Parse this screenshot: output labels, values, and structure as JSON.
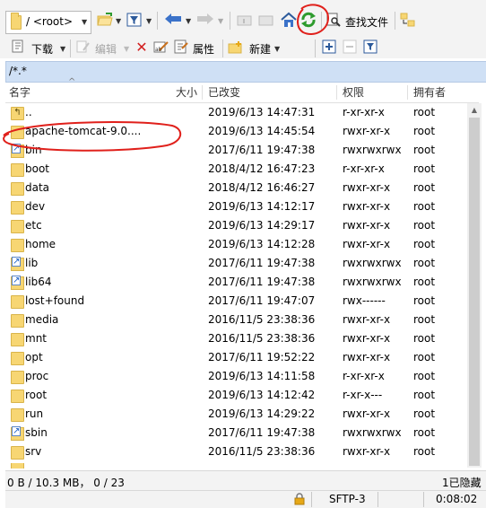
{
  "toolbar_top": {
    "path_combo_value": "/ <root>",
    "find_files_label": "查找文件"
  },
  "toolbar_second": {
    "download_label": "下载",
    "edit_label": "编辑",
    "properties_label": "属性",
    "new_label": "新建"
  },
  "path_bar": {
    "path": "/*.*"
  },
  "columns": {
    "name": "名字",
    "size": "大小",
    "changed": "已改变",
    "rights": "权限",
    "owner": "拥有者"
  },
  "files": [
    {
      "name": "..",
      "changed": "2019/6/13 14:47:31",
      "rights": "r-xr-xr-x",
      "owner": "root",
      "icon": "parent-directory-icon"
    },
    {
      "name": "apache-tomcat-9.0....",
      "changed": "2019/6/13 14:45:54",
      "rights": "rwxr-xr-x",
      "owner": "root",
      "icon": "folder-icon"
    },
    {
      "name": "bin",
      "changed": "2017/6/11 19:47:38",
      "rights": "rwxrwxrwx",
      "owner": "root",
      "icon": "folder-link-icon"
    },
    {
      "name": "boot",
      "changed": "2018/4/12 16:47:23",
      "rights": "r-xr-xr-x",
      "owner": "root",
      "icon": "folder-icon"
    },
    {
      "name": "data",
      "changed": "2018/4/12 16:46:27",
      "rights": "rwxr-xr-x",
      "owner": "root",
      "icon": "folder-icon"
    },
    {
      "name": "dev",
      "changed": "2019/6/13 14:12:17",
      "rights": "rwxr-xr-x",
      "owner": "root",
      "icon": "folder-icon"
    },
    {
      "name": "etc",
      "changed": "2019/6/13 14:29:17",
      "rights": "rwxr-xr-x",
      "owner": "root",
      "icon": "folder-icon"
    },
    {
      "name": "home",
      "changed": "2019/6/13 14:12:28",
      "rights": "rwxr-xr-x",
      "owner": "root",
      "icon": "folder-icon"
    },
    {
      "name": "lib",
      "changed": "2017/6/11 19:47:38",
      "rights": "rwxrwxrwx",
      "owner": "root",
      "icon": "folder-link-icon"
    },
    {
      "name": "lib64",
      "changed": "2017/6/11 19:47:38",
      "rights": "rwxrwxrwx",
      "owner": "root",
      "icon": "folder-link-icon"
    },
    {
      "name": "lost+found",
      "changed": "2017/6/11 19:47:07",
      "rights": "rwx------",
      "owner": "root",
      "icon": "folder-icon"
    },
    {
      "name": "media",
      "changed": "2016/11/5 23:38:36",
      "rights": "rwxr-xr-x",
      "owner": "root",
      "icon": "folder-icon"
    },
    {
      "name": "mnt",
      "changed": "2016/11/5 23:38:36",
      "rights": "rwxr-xr-x",
      "owner": "root",
      "icon": "folder-icon"
    },
    {
      "name": "opt",
      "changed": "2017/6/11 19:52:22",
      "rights": "rwxr-xr-x",
      "owner": "root",
      "icon": "folder-icon"
    },
    {
      "name": "proc",
      "changed": "2019/6/13 14:11:58",
      "rights": "r-xr-xr-x",
      "owner": "root",
      "icon": "folder-icon"
    },
    {
      "name": "root",
      "changed": "2019/6/13 14:12:42",
      "rights": "r-xr-x---",
      "owner": "root",
      "icon": "folder-icon"
    },
    {
      "name": "run",
      "changed": "2019/6/13 14:29:22",
      "rights": "rwxr-xr-x",
      "owner": "root",
      "icon": "folder-icon"
    },
    {
      "name": "sbin",
      "changed": "2017/6/11 19:47:38",
      "rights": "rwxrwxrwx",
      "owner": "root",
      "icon": "folder-link-icon"
    },
    {
      "name": "srv",
      "changed": "2016/11/5 23:38:36",
      "rights": "rwxr-xr-x",
      "owner": "root",
      "icon": "folder-icon"
    }
  ],
  "status_bar": {
    "selection": "0 B / 10.3 MB， 0 / 23",
    "hidden": "1已隐藏",
    "protocol": "SFTP-3",
    "elapsed": "0:08:02"
  },
  "colors": {
    "path_bar_bg": "#cfe0f5",
    "annotation_red": "#e0201b",
    "refresh_green": "#2e9b2e",
    "delete_red": "#d21f1f"
  }
}
